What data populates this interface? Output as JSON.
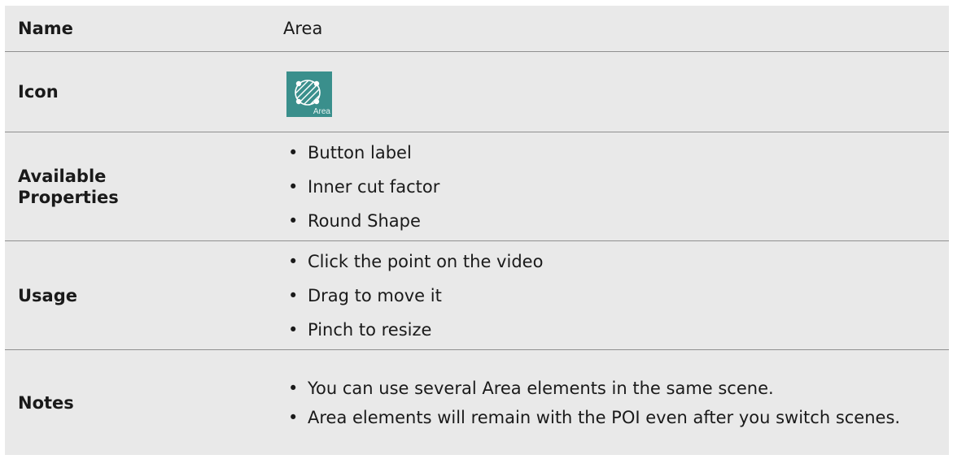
{
  "rows": {
    "name": {
      "label": "Name",
      "value": "Area"
    },
    "icon": {
      "label": "Icon",
      "icon_name": "area-icon",
      "icon_text": "Area",
      "icon_color": "#3a8f8c"
    },
    "properties": {
      "label_line1": "Available",
      "label_line2": "Properties",
      "items": [
        "Button label",
        "Inner cut factor",
        "Round Shape"
      ]
    },
    "usage": {
      "label": "Usage",
      "items": [
        "Click the point on the video",
        "Drag to move it",
        "Pinch to resize"
      ]
    },
    "notes": {
      "label": "Notes",
      "items": [
        "You can use several Area elements in the same scene.",
        "Area elements will remain with the POI even after you switch scenes."
      ]
    }
  }
}
